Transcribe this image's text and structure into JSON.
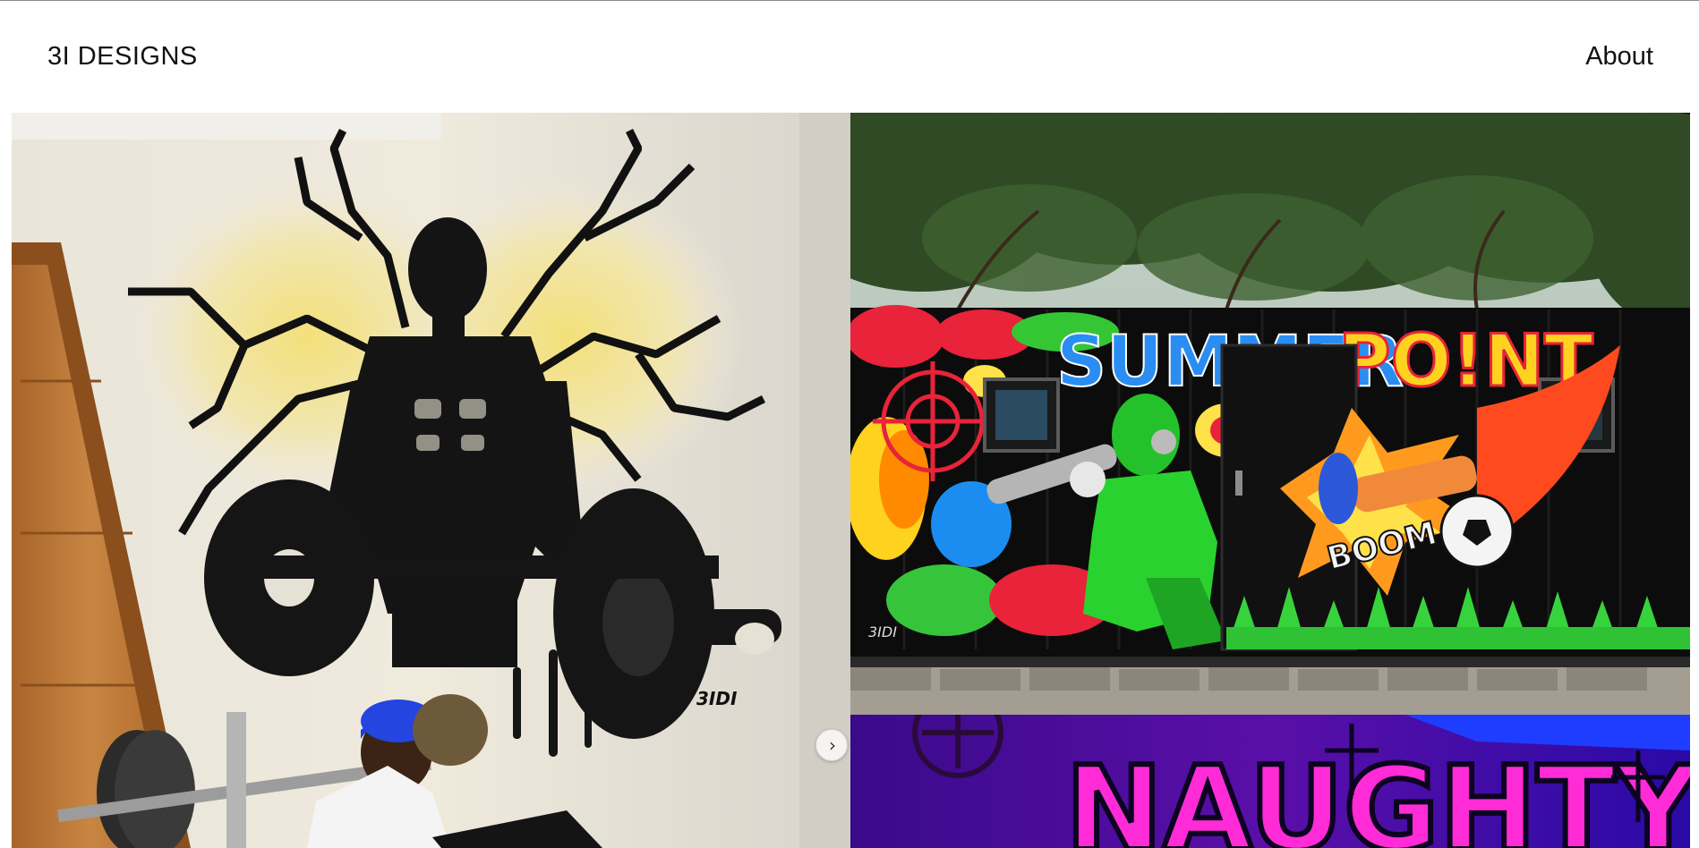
{
  "header": {
    "brand": "3I DESIGNS",
    "nav_about": "About"
  },
  "gallery": {
    "tiles": [
      {
        "name": "gym-mural",
        "signature": "3IDI"
      },
      {
        "name": "container-mural",
        "headline_left": "SUMMER",
        "headline_right": "PO!NT",
        "splash_word": "BOOM",
        "signature": "3IDI"
      },
      {
        "name": "neon-mural",
        "headline": "NAUGHTY"
      }
    ],
    "next_icon": "chevron-right-icon"
  },
  "colors": {
    "text": "#111111",
    "background": "#ffffff",
    "rule": "#8a8a8a"
  }
}
